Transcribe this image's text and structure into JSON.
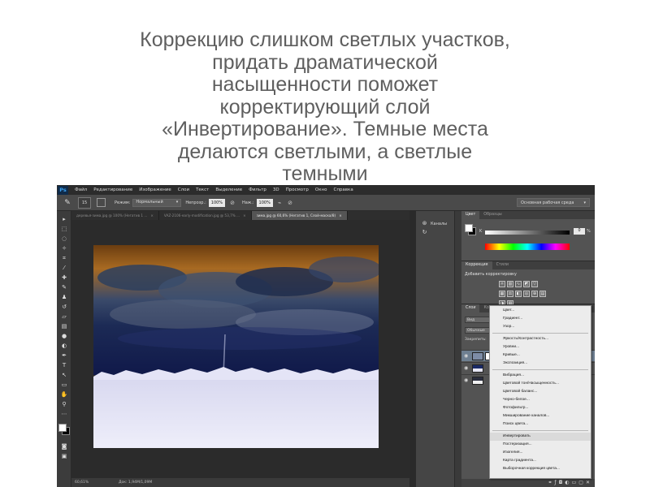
{
  "caption": {
    "lines": [
      "Коррекцию слишком светлых участков,",
      "придать драматической",
      "насыщенности  поможет",
      "корректирующий слой",
      "«Инвертирование». Темные места",
      "делаются светлыми, а светлые",
      "темными"
    ]
  },
  "app": {
    "logo": "Ps",
    "menu": [
      "Файл",
      "Редактирование",
      "Изображение",
      "Слои",
      "Текст",
      "Выделение",
      "Фильтр",
      "3D",
      "Просмотр",
      "Окно",
      "Справка"
    ]
  },
  "options": {
    "brush_size": "15",
    "mode_label": "Режим:",
    "mode_value": "Нормальный",
    "opacity_label": "Непрозр.:",
    "opacity_value": "100%",
    "flow_label": "Наж.:",
    "flow_value": "100%",
    "workspace": "Основная рабочая среда"
  },
  "doc_tabs": [
    {
      "label": "деревья-зима.jpg @ 100% (Негатив 1 ..."
    },
    {
      "label": "VAZ-2106-early-modification.jpg @ 53,7% ..."
    },
    {
      "label": "зима.jpg @ 60,6% (Негатив 1, Слой-маска/8)",
      "active": true
    }
  ],
  "status": {
    "zoom": "60,61%",
    "doc": "Док: 1,94М/1,09М"
  },
  "mini_dock": {
    "channels": "Каналы"
  },
  "color_panel": {
    "tabs": [
      "Цвет",
      "Образцы"
    ],
    "channel_label": "K",
    "value": "0",
    "unit": "%"
  },
  "adjustments_panel": {
    "tabs": [
      "Коррекция",
      "Стили"
    ],
    "title": "Добавить корректировку"
  },
  "layers_panel": {
    "tabs": [
      "Слои",
      "Контуры"
    ],
    "search": "Вид",
    "blend": "Обычные",
    "lock": "Закрепить:"
  },
  "adjustment_menu": {
    "groups": [
      [
        "Цвет...",
        "Градиент...",
        "Узор..."
      ],
      [
        "Яркость/Контрастность...",
        "Уровни...",
        "Кривые...",
        "Экспозиция..."
      ],
      [
        "Вибрация...",
        "Цветовой тон/Насыщенность...",
        "Цветовой баланс...",
        "Черно-белое...",
        "Фотофильтр...",
        "Микширование каналов...",
        "Поиск цвета..."
      ],
      [
        "Инвертировать",
        "Постеризация...",
        "Изогелия...",
        "Карта градиента...",
        "Выборочная коррекция цвета..."
      ]
    ],
    "highlighted": "Инвертировать"
  },
  "colors": {
    "caption_text": "#5f5f5f",
    "workspace_bg": "#2b2b2b",
    "menu_bg": "#ececec",
    "selected_layer": "#6e7f91"
  }
}
